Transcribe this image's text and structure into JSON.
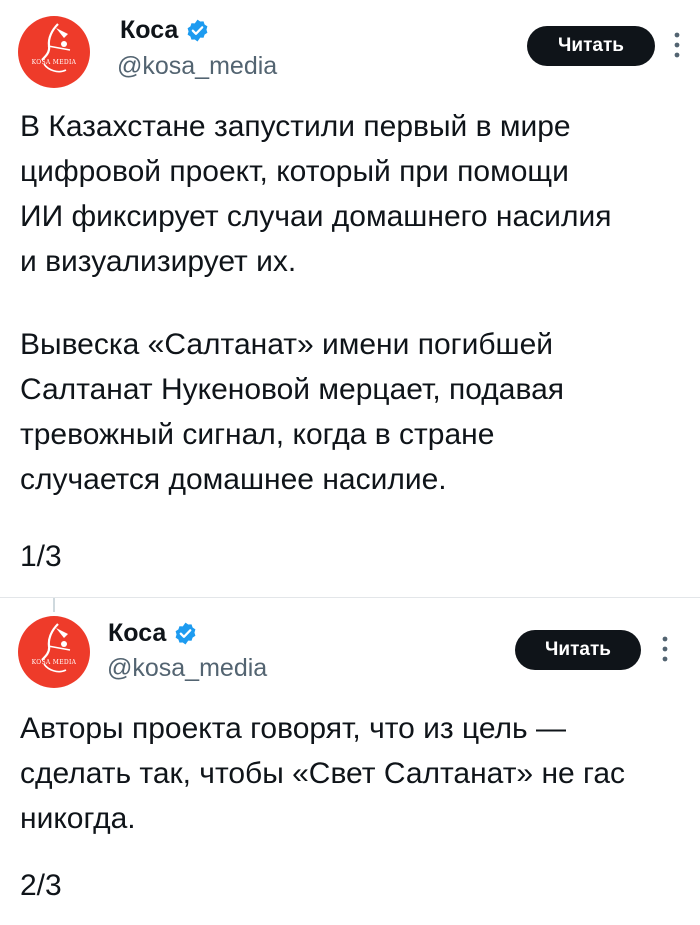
{
  "tweets": [
    {
      "author_name": "Коса",
      "handle": "@kosa_media",
      "avatar_text": "KOSA MEDIA",
      "read_button": "Читать",
      "paragraphs": [
        [
          "В Казахстане запустили первый в мире",
          "цифровой проект, который при помощи",
          "ИИ фиксирует случаи домашнего насилия",
          "и визуализирует их."
        ],
        [
          "Вывеска «Салтанат» имени погибшей",
          "Салтанат Нукеновой мерцает, подавая",
          "тревожный сигнал, когда в стране",
          "случается домашнее насилие."
        ]
      ],
      "counter": "1/3"
    },
    {
      "author_name": "Коса",
      "handle": "@kosa_media",
      "avatar_text": "KOSA MEDIA",
      "read_button": "Читать",
      "paragraphs": [
        [
          "Авторы проекта говорят, что из цель —",
          "сделать так, чтобы «Свет Салтанат» не гас",
          "никогда."
        ]
      ],
      "counter": "2/3"
    }
  ],
  "colors": {
    "avatar_bg": "#ee3b2a",
    "verified": "#1d9bf0",
    "button_bg": "#0f1419",
    "text": "#0f1419",
    "secondary_text": "#536471"
  },
  "icons": [
    "verified-badge-icon",
    "more-options-icon",
    "avatar-logo"
  ]
}
